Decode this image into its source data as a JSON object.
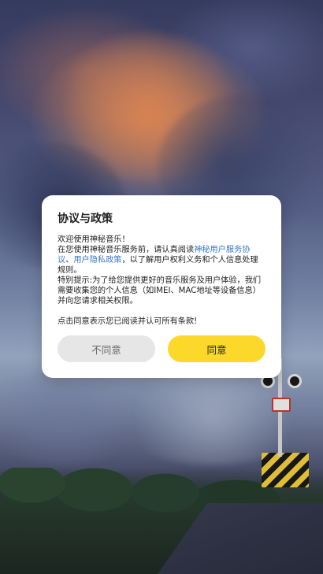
{
  "dialog": {
    "title": "协议与政策",
    "welcome": "欢迎使用神秘音乐！",
    "intro_before": "在您使用神秘音乐服务前，请认真阅读",
    "link_service": "神秘用户服务协议",
    "separator": "、",
    "link_privacy": "用户隐私政策",
    "intro_after": "，以了解用户权利义务和个人信息处理规则。",
    "notice": "特别提示:为了给您提供更好的音乐服务及用户体验，我们需要收集您的个人信息（如IMEI、MAC地址等设备信息）并向您请求相关权限。",
    "consent": "点击同意表示您已阅读并认可所有条款!",
    "disagree_label": "不同意",
    "agree_label": "同意"
  },
  "colors": {
    "link": "#3b78c4",
    "agree_button": "#fcd82b",
    "disagree_button": "#e6e6e6"
  }
}
